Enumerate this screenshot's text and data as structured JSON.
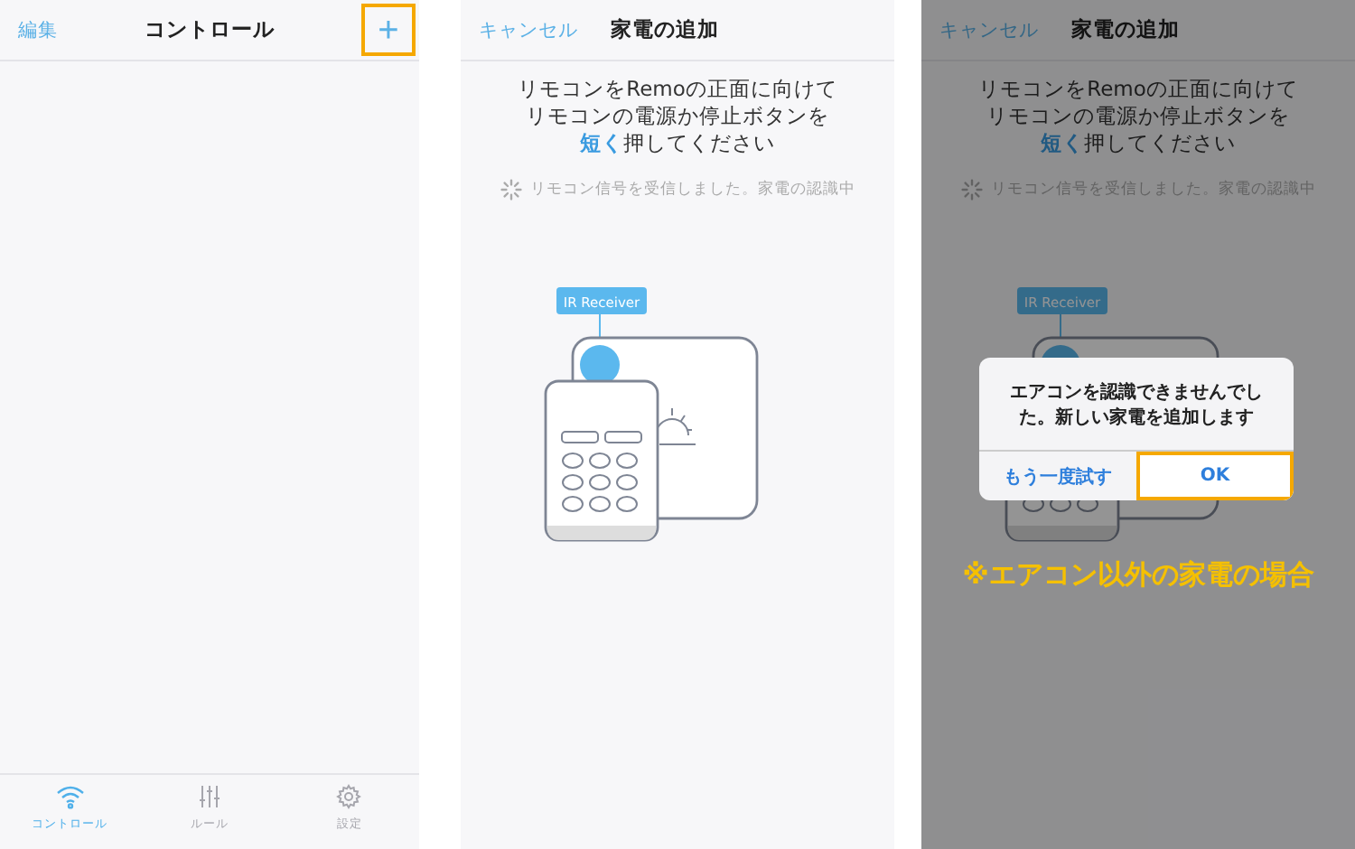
{
  "screens": [
    {
      "kind": "home",
      "nav": {
        "left": "編集",
        "title": "コントロール",
        "action": "+",
        "action_highlighted": true
      },
      "tabs": [
        {
          "label": "コントロール",
          "selected": true
        },
        {
          "label": "ルール",
          "selected": false
        },
        {
          "label": "設定",
          "selected": false
        }
      ]
    },
    {
      "kind": "add",
      "dimmed": false,
      "nav": {
        "left": "キャンセル",
        "title": "家電の追加"
      },
      "instruction_lines": [
        "リモコンをRemoの正面に向けて",
        "リモコンの電源か停止ボタンを"
      ],
      "instruction_highlight": "短く",
      "instruction_rest": "押してください",
      "status": "リモコン信号を受信しました。家電の認識中",
      "receiver_label": "IR Receiver"
    },
    {
      "kind": "add",
      "dimmed": true,
      "nav": {
        "left": "キャンセル",
        "title": "家電の追加"
      },
      "instruction_lines": [
        "リモコンをRemoの正面に向けて",
        "リモコンの電源か停止ボタンを"
      ],
      "instruction_highlight": "短く",
      "instruction_rest": "押してください",
      "status": "リモコン信号を受信しました。家電の認識中",
      "receiver_label": "IR Receiver",
      "dialog": {
        "message": "エアコンを認識できませんでした。新しい家電を追加します",
        "buttons": [
          {
            "label": "もう一度試す",
            "highlighted": false
          },
          {
            "label": "OK",
            "highlighted": true
          }
        ]
      },
      "caption": "※エアコン以外の家電の場合"
    }
  ]
}
